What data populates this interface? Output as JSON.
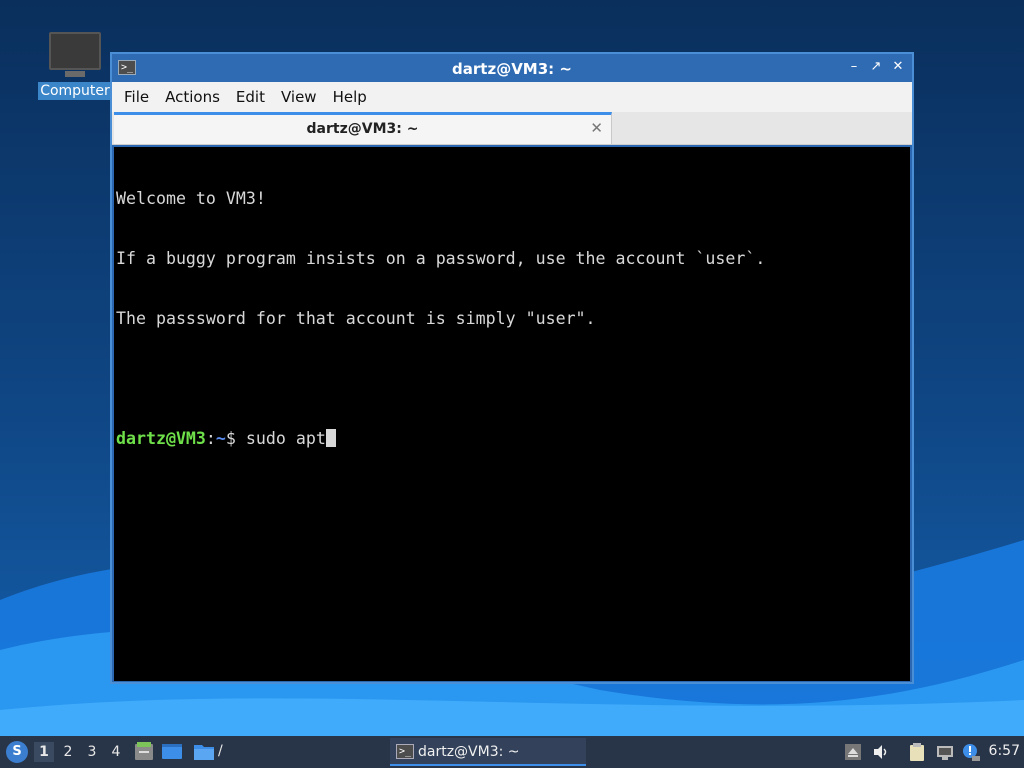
{
  "desktop": {
    "icons": [
      {
        "label": "Computer"
      }
    ]
  },
  "window": {
    "title": "dartz@VM3: ~",
    "menu": [
      "File",
      "Actions",
      "Edit",
      "View",
      "Help"
    ],
    "tab": {
      "label": "dartz@VM3: ~"
    },
    "terminal": {
      "lines": [
        "Welcome to VM3!",
        "If a buggy program insists on a password, use the account `user`.",
        "The passsword for that account is simply \"user\"."
      ],
      "prompt": {
        "user_host": "dartz@VM3",
        "colon": ":",
        "path": "~",
        "symbol": "$ ",
        "command": "sudo apt"
      }
    }
  },
  "taskbar": {
    "workspaces": [
      "1",
      "2",
      "3",
      "4"
    ],
    "active_workspace": "1",
    "folder_slash": "/",
    "task": {
      "label": "dartz@VM3: ~"
    },
    "clock": "6:57"
  },
  "colors": {
    "accent": "#3d8ee8",
    "prompt_user": "#6fe04a",
    "prompt_path": "#5a8cf0",
    "terminal_bg": "#000000"
  }
}
